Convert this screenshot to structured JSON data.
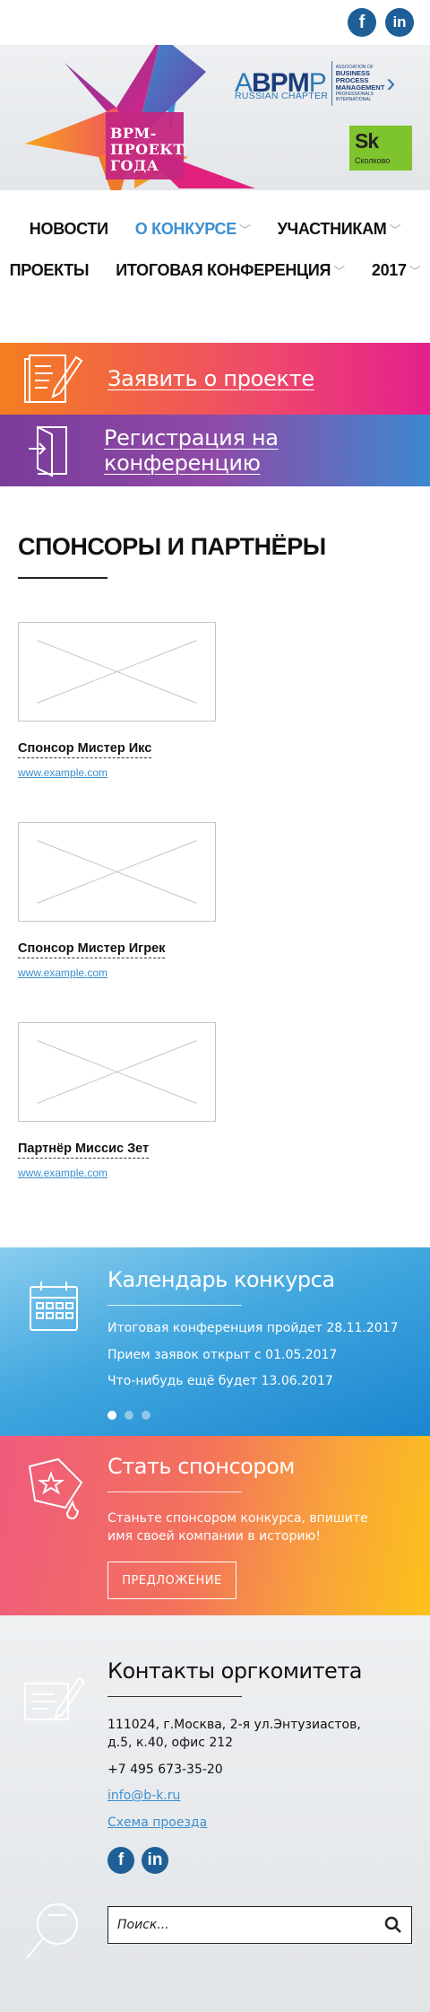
{
  "social": {
    "facebook_icon": "facebook-icon",
    "linkedin_icon": "linkedin-icon",
    "facebook_glyph": "f",
    "linkedin_glyph": "in"
  },
  "header": {
    "title_line1": "BPM-",
    "title_line2": "ПРОЕКТ",
    "title_line3": "ГОДА",
    "abpmp_a": "A",
    "abpmp_bpm": "BPM",
    "abpmp_p": "P",
    "abpmp_sub": "RUSSIAN CHAPTER",
    "abpmp_small_top": "ASSOCIATION OF",
    "abpmp_r1": "BUSINESS",
    "abpmp_r2": "PROCESS",
    "abpmp_r3": "MANAGEMENT",
    "abpmp_small_bottom1": "PROFESSIONALS",
    "abpmp_small_bottom2": "INTERNATIONAL",
    "sk_mark": "Sk",
    "sk_label": "Сколково"
  },
  "nav": {
    "row1": [
      "НОВОСТИ",
      "О КОНКУРСЕ",
      "УЧАСТНИКАМ"
    ],
    "row2": [
      "ПРОЕКТЫ",
      "ИТОГОВАЯ КОНФЕРЕНЦИЯ",
      "2017"
    ]
  },
  "cta": {
    "apply": "Заявить о проекте",
    "register": "Регистрация на конференцию"
  },
  "sponsors": {
    "heading": "СПОНСОРЫ И ПАРТНЁРЫ",
    "items": [
      {
        "name": "Спонсор Мистер Икс",
        "url": "www.example.com"
      },
      {
        "name": "Спонсор Мистер Игрек",
        "url": "www.example.com"
      },
      {
        "name": "Партнёр Миссис Зет",
        "url": "www.example.com"
      }
    ]
  },
  "calendar": {
    "title": "Календарь конкурса",
    "events": [
      "Итоговая конференция пройдет 28.11.2017",
      "Прием заявок открыт с 01.05.2017",
      "Что-нибудь ещё будет 13.06.2017"
    ],
    "active_slide": 1,
    "slide_count": 3
  },
  "become_sponsor": {
    "title": "Стать спонсором",
    "description": "Станьте спонсором конкурса, впишите имя своей компании в историю!",
    "button": "ПРЕДЛОЖЕНИЕ"
  },
  "contacts": {
    "title": "Контакты оргкомитета",
    "address": "111024, г.Москва, 2-я ул.Энтузиастов, д.5, к.40, офис 212",
    "phone": "+7 495 673-35-20",
    "email": "info@b-k.ru",
    "route": "Схема проезда"
  },
  "search": {
    "placeholder": "Поиск..."
  },
  "colors": {
    "accent": "#3c8fd0",
    "brand_dark": "#1d5f96",
    "cta_orange": "#f47e20",
    "cta_magenta": "#e4208e",
    "cta_purple": "#7a3c99",
    "calendar_blue": "#1a86cf",
    "sponsor_yellow": "#fbc21a"
  }
}
